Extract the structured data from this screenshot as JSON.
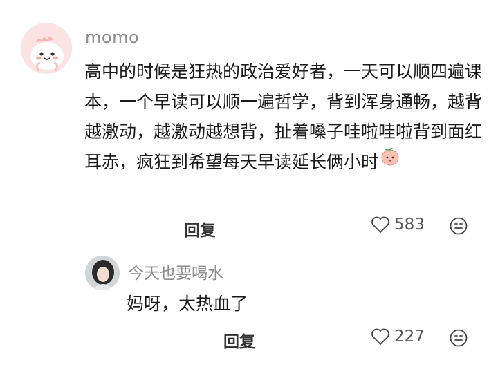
{
  "comment": {
    "username": "momo",
    "text": "高中的时候是狂热的政治爱好者，一天可以顺四遍课本，一个早读可以顺一遍哲学，背到浑身通畅，越背越激动，越激动越想背，扯着嗓子哇啦哇啦背到面红耳赤，疯狂到希望每天早读延长俩小时",
    "emoji": "peach-face-emoji",
    "reply_label": "回复",
    "like_count": "583"
  },
  "reply": {
    "username": "今天也要喝水",
    "text": "妈呀，太热血了",
    "reply_label": "回复",
    "like_count": "227"
  },
  "colors": {
    "username": "#8c8c8c",
    "text": "#1a1a1a",
    "avatar_bg": "#fbe4e4"
  }
}
